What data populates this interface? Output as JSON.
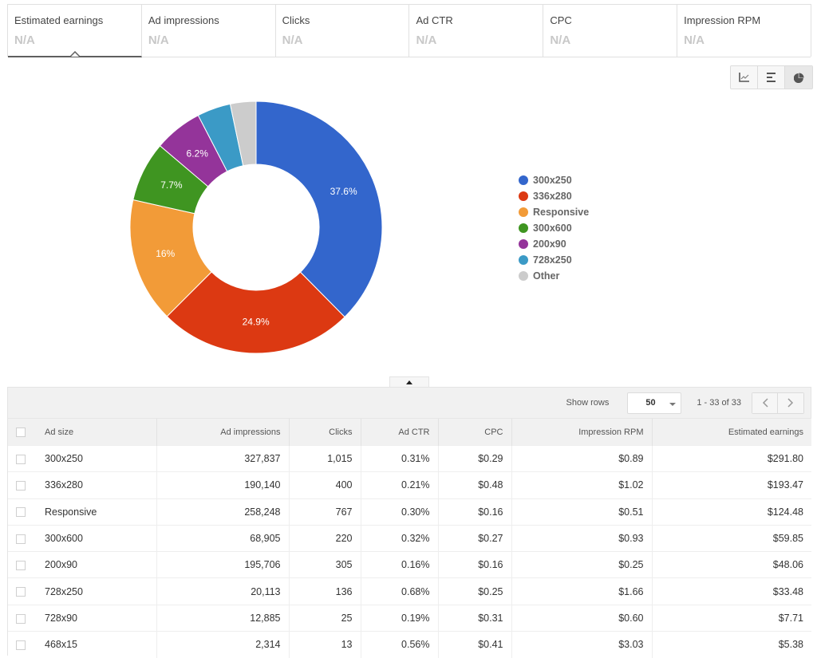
{
  "metrics": [
    {
      "label": "Estimated earnings",
      "value": "N/A",
      "active": true
    },
    {
      "label": "Ad impressions",
      "value": "N/A",
      "active": false
    },
    {
      "label": "Clicks",
      "value": "N/A",
      "active": false
    },
    {
      "label": "Ad CTR",
      "value": "N/A",
      "active": false
    },
    {
      "label": "CPC",
      "value": "N/A",
      "active": false
    },
    {
      "label": "Impression RPM",
      "value": "N/A",
      "active": false
    }
  ],
  "chart_toggles": [
    {
      "icon": "line-chart-icon",
      "active": false
    },
    {
      "icon": "bar-chart-icon",
      "active": false
    },
    {
      "icon": "pie-chart-icon",
      "active": true
    }
  ],
  "chart_data": {
    "type": "pie",
    "donut": true,
    "title": "",
    "categories": [
      "300x250",
      "336x280",
      "Responsive",
      "300x600",
      "200x90",
      "728x250",
      "Other"
    ],
    "values": [
      37.6,
      24.9,
      16,
      7.7,
      6.2,
      4.3,
      3.3
    ],
    "labels": [
      "37.6%",
      "24.9%",
      "16%",
      "7.7%",
      "6.2%",
      "",
      ""
    ],
    "colors": [
      "#3366cc",
      "#dc3912",
      "#f29b38",
      "#3f9521",
      "#94349a",
      "#3b9ac6",
      "#cccccc"
    ],
    "legend_position": "right"
  },
  "collapse_toggle": "collapse-chart",
  "table": {
    "show_rows_label": "Show rows",
    "rows_per_page": "50",
    "range": "1 - 33 of 33",
    "prev_icon": "‹",
    "next_icon": "›",
    "columns": [
      "Ad size",
      "Ad impressions",
      "Clicks",
      "Ad CTR",
      "CPC",
      "Impression RPM",
      "Estimated earnings"
    ],
    "rows": [
      [
        "300x250",
        "327,837",
        "1,015",
        "0.31%",
        "$0.29",
        "$0.89",
        "$291.80"
      ],
      [
        "336x280",
        "190,140",
        "400",
        "0.21%",
        "$0.48",
        "$1.02",
        "$193.47"
      ],
      [
        "Responsive",
        "258,248",
        "767",
        "0.30%",
        "$0.16",
        "$0.51",
        "$124.48"
      ],
      [
        "300x600",
        "68,905",
        "220",
        "0.32%",
        "$0.27",
        "$0.93",
        "$59.85"
      ],
      [
        "200x90",
        "195,706",
        "305",
        "0.16%",
        "$0.16",
        "$0.25",
        "$48.06"
      ],
      [
        "728x250",
        "20,113",
        "136",
        "0.68%",
        "$0.25",
        "$1.66",
        "$33.48"
      ],
      [
        "728x90",
        "12,885",
        "25",
        "0.19%",
        "$0.31",
        "$0.60",
        "$7.71"
      ],
      [
        "468x15",
        "2,314",
        "13",
        "0.56%",
        "$0.41",
        "$3.03",
        "$5.38"
      ]
    ]
  }
}
